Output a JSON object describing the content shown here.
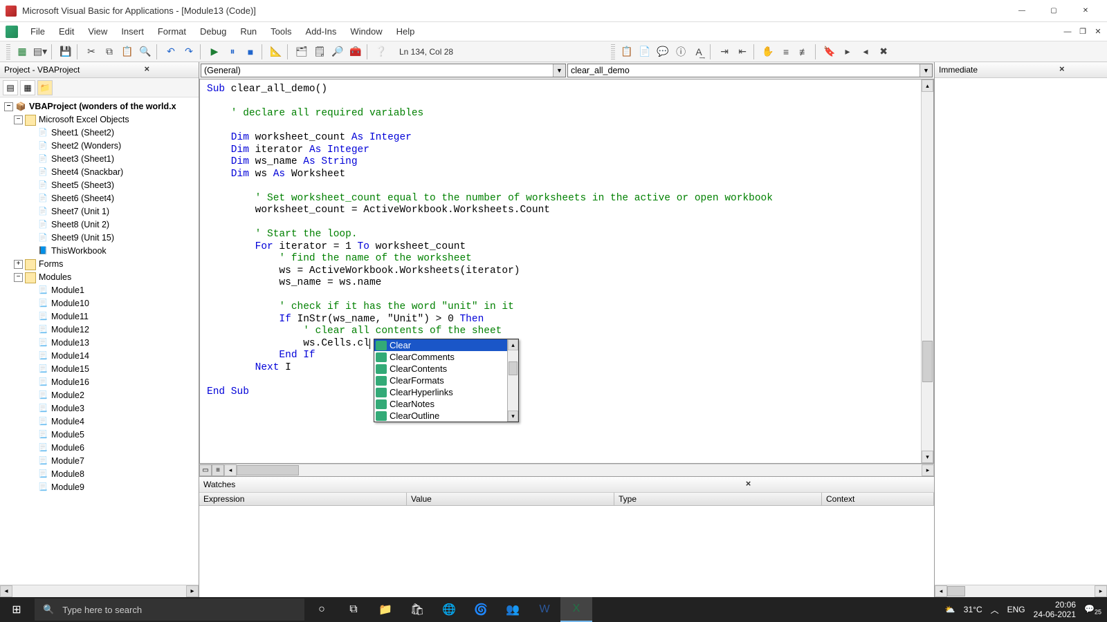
{
  "title_bar": {
    "text": "Microsoft Visual Basic for Applications - [Module13 (Code)]"
  },
  "menus": [
    "File",
    "Edit",
    "View",
    "Insert",
    "Format",
    "Debug",
    "Run",
    "Tools",
    "Add-Ins",
    "Window",
    "Help"
  ],
  "cursor_position": "Ln 134, Col 28",
  "project_panel_title": "Project - VBAProject",
  "tree": {
    "project": "VBAProject (wonders of the world.x",
    "excel_objects_label": "Microsoft Excel Objects",
    "sheets": [
      "Sheet1 (Sheet2)",
      "Sheet2 (Wonders)",
      "Sheet3 (Sheet1)",
      "Sheet4 (Snackbar)",
      "Sheet5 (Sheet3)",
      "Sheet6 (Sheet4)",
      "Sheet7 (Unit 1)",
      "Sheet8 (Unit 2)",
      "Sheet9 (Unit 15)"
    ],
    "thisworkbook": "ThisWorkbook",
    "forms_label": "Forms",
    "modules_label": "Modules",
    "modules": [
      "Module1",
      "Module10",
      "Module11",
      "Module12",
      "Module13",
      "Module14",
      "Module15",
      "Module16",
      "Module2",
      "Module3",
      "Module4",
      "Module5",
      "Module6",
      "Module7",
      "Module8",
      "Module9"
    ]
  },
  "combo_left": "(General)",
  "combo_right": "clear_all_demo",
  "code": {
    "l1": "Sub clear_all_demo()",
    "l1a": "Sub",
    "l2": "    ' declare all required variables",
    "l3a": "    Dim",
    "l3b": " worksheet_count ",
    "l3c": "As Integer",
    "l4a": "    Dim",
    "l4b": " iterator ",
    "l4c": "As Integer",
    "l5a": "    Dim",
    "l5b": " ws_name ",
    "l5c": "As String",
    "l6a": "    Dim",
    "l6b": " ws ",
    "l6c": "As",
    "l6d": " Worksheet",
    "l7": "        ' Set worksheet_count equal to the number of worksheets in the active or open workbook",
    "l8": "        worksheet_count = ActiveWorkbook.Worksheets.Count",
    "l9": "        ' Start the loop.",
    "l10a": "        For",
    "l10b": " iterator = 1 ",
    "l10c": "To",
    "l10d": " worksheet_count",
    "l11": "            ' find the name of the worksheet",
    "l12": "            ws = ActiveWorkbook.Worksheets(iterator)",
    "l13": "            ws_name = ws.name",
    "l14": "            ' check if it has the word \"unit\" in it",
    "l15a": "            If",
    "l15b": " InStr(ws_name, \"Unit\") > 0 ",
    "l15c": "Then",
    "l16": "                ' clear all contents of the sheet",
    "l17": "                ws.Cells.cl",
    "l18": "            End If",
    "l19a": "        Next",
    "l19b": " I",
    "l20": "End Sub"
  },
  "intellisense": [
    "Clear",
    "ClearComments",
    "ClearContents",
    "ClearFormats",
    "ClearHyperlinks",
    "ClearNotes",
    "ClearOutline"
  ],
  "watches": {
    "title": "Watches",
    "cols": [
      "Expression",
      "Value",
      "Type",
      "Context"
    ]
  },
  "immediate_title": "Immediate",
  "taskbar": {
    "search_placeholder": "Type here to search",
    "temp": "31°C",
    "lang": "ENG",
    "time": "20:06",
    "date": "24-06-2021",
    "notif": "25"
  }
}
